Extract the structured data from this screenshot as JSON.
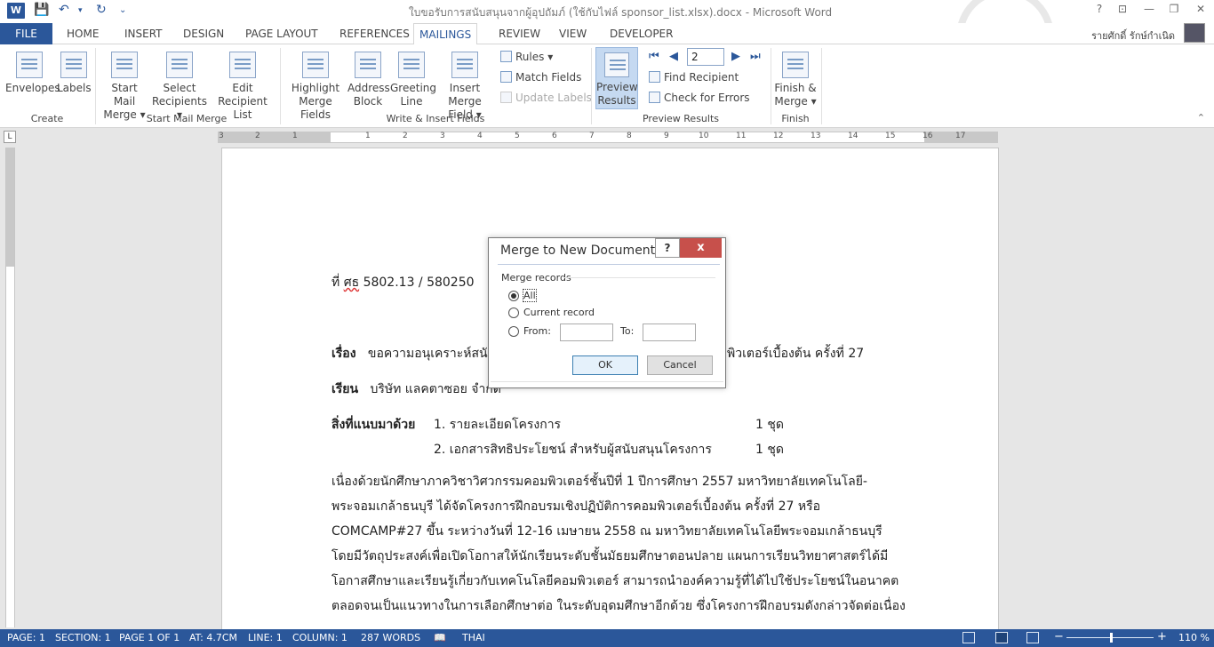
{
  "window": {
    "title": "ใบขอรับการสนับสนุนจากผู้อุปถัมภ์ (ใช้กับไฟล์ sponsor_list.xlsx).docx - Microsoft Word",
    "help": "?",
    "controls": [
      "⊡",
      "—",
      "❐",
      "✕"
    ]
  },
  "tabs": {
    "file": "FILE",
    "items": [
      "HOME",
      "INSERT",
      "DESIGN",
      "PAGE LAYOUT",
      "REFERENCES",
      "MAILINGS",
      "REVIEW",
      "VIEW",
      "DEVELOPER"
    ],
    "active": "MAILINGS",
    "user": "รายศักดิ์ รักษ์กำเนิด"
  },
  "ribbon": {
    "create": {
      "label": "Create",
      "envelopes": "Envelopes",
      "labels": "Labels"
    },
    "start": {
      "label": "Start Mail Merge",
      "start_line1": "Start Mail",
      "start_line2": "Merge ▾",
      "select_line1": "Select",
      "select_line2": "Recipients ▾",
      "edit_line1": "Edit",
      "edit_line2": "Recipient List"
    },
    "write": {
      "label": "Write & Insert Fields",
      "highlight_line1": "Highlight",
      "highlight_line2": "Merge Fields",
      "address_line1": "Address",
      "address_line2": "Block",
      "greeting_line1": "Greeting",
      "greeting_line2": "Line",
      "insert_line1": "Insert Merge",
      "insert_line2": "Field ▾",
      "rules": "Rules ▾",
      "match": "Match Fields",
      "update": "Update Labels"
    },
    "preview": {
      "label": "Preview Results",
      "preview_line1": "Preview",
      "preview_line2": "Results",
      "record": "2",
      "find": "Find Recipient",
      "check": "Check for Errors"
    },
    "finish": {
      "label": "Finish",
      "finish_line1": "Finish &",
      "finish_line2": "Merge ▾"
    }
  },
  "ruler": {
    "numbers": [
      "3",
      "2",
      "1",
      "1",
      "2",
      "3",
      "4",
      "5",
      "6",
      "7",
      "8",
      "9",
      "10",
      "11",
      "12",
      "13",
      "14",
      "15",
      "16",
      "17"
    ]
  },
  "document": {
    "ref_prefix": "ที่",
    "ref_code": "ศธ",
    "ref_number": "5802.13 / 580250",
    "subject_label": "เรื่อง",
    "subject_text_left": "ขอความอนุเคราะห์สนั",
    "subject_text_right": "พิวเตอร์เบื้องต้น ครั้งที่ 27",
    "to_label": "เรียน",
    "to_text": "บริษัท แลคตาซอย จำกัด",
    "enclosure_label": "สิ่งที่แนบมาด้วย",
    "enclosure_1": "1. รายละเอียดโครงการ",
    "enclosure_1_qty": "1 ชุด",
    "enclosure_2": "2. เอกสารสิทธิประโยชน์ สำหรับผู้สนับสนุนโครงการ",
    "enclosure_2_qty": "1 ชุด",
    "body": [
      "        เนื่องด้วยนักศึกษาภาควิชาวิศวกรรมคอมพิวเตอร์ชั้นปีที่ 1 ปีการศึกษา 2557 มหาวิทยาลัยเทคโนโลยี-",
      "พระจอมเกล้าธนบุรี ได้จัดโครงการฝึกอบรมเชิงปฏิบัติการคอมพิวเตอร์เบื้องต้น ครั้งที่ 27 หรือ",
      "COMCAMP#27 ขึ้น ระหว่างวันที่ 12-16 เมษายน 2558 ณ มหาวิทยาลัยเทคโนโลยีพระจอมเกล้าธนบุรี",
      "โดยมีวัตถุประสงค์เพื่อเปิดโอกาสให้นักเรียนระดับชั้นมัธยมศึกษาตอนปลาย แผนการเรียนวิทยาศาสตร์ได้มี",
      "โอกาสศึกษาและเรียนรู้เกี่ยวกับเทคโนโลยีคอมพิวเตอร์ สามารถนำองค์ความรู้ที่ได้ไปใช้ประโยชน์ในอนาคต",
      "ตลอดจนเป็นแนวทางในการเลือกศึกษาต่อ ในระดับอุดมศึกษาอีกด้วย ซึ่งโครงการฝึกอบรมดังกล่าวจัดต่อเนื่อง"
    ]
  },
  "dialog": {
    "title": "Merge to New Document",
    "help": "?",
    "close": "x",
    "group": "Merge records",
    "all": "All",
    "current": "Current record",
    "from": "From:",
    "to": "To:",
    "from_value": "",
    "to_value": "",
    "ok": "OK",
    "cancel": "Cancel",
    "selected": "all"
  },
  "status": {
    "page": "PAGE: 1",
    "section": "SECTION: 1",
    "pageof": "PAGE 1 OF 1",
    "at": "AT: 4.7CM",
    "line": "LINE: 1",
    "column": "COLUMN: 1",
    "words": "287 WORDS",
    "lang": "THAI",
    "zoom": "110 %",
    "minus": "−",
    "plus": "+"
  },
  "colors": {
    "accent": "#2b579a",
    "close_red": "#c7504b"
  }
}
